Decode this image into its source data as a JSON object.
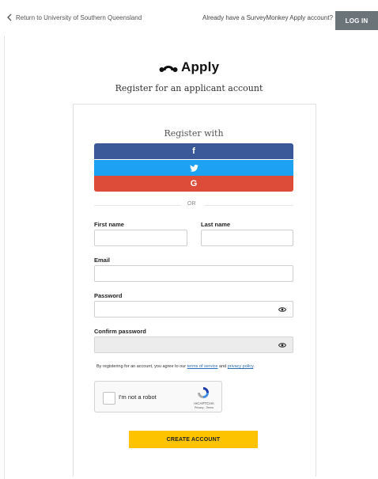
{
  "header": {
    "return_label": "Return to University of Southern Queensland",
    "already_text": "Already have a SurveyMonkey Apply account?",
    "login_label": "LOG IN"
  },
  "brand": {
    "logo_text": "Apply",
    "subtitle": "Register for an applicant account"
  },
  "register": {
    "heading": "Register with",
    "facebook_icon": "facebook-icon",
    "twitter_icon": "twitter-icon",
    "google_icon": "google-icon",
    "facebook_glyph": "f",
    "google_glyph": "G",
    "or_text": "OR"
  },
  "form": {
    "first_name_label": "First name",
    "first_name_value": "",
    "last_name_label": "Last name",
    "last_name_value": "",
    "email_label": "Email",
    "email_value": "",
    "password_label": "Password",
    "password_value": "",
    "confirm_password_label": "Confirm password",
    "confirm_password_value": ""
  },
  "terms": {
    "prefix": "By registering for an account, you agree to our ",
    "terms_link": "terms of service",
    "and": " and ",
    "privacy_link": "privacy policy",
    "suffix": "."
  },
  "captcha": {
    "label": "I'm not a robot",
    "brand": "reCAPTCHA",
    "privacy": "Privacy - Terms"
  },
  "submit": {
    "label": "CREATE ACCOUNT"
  },
  "colors": {
    "facebook": "#3b5998",
    "twitter": "#1da1f2",
    "google": "#dd4b39",
    "create_button": "#fdc300",
    "login_button": "#6b7479",
    "link": "#2a6bb5"
  }
}
